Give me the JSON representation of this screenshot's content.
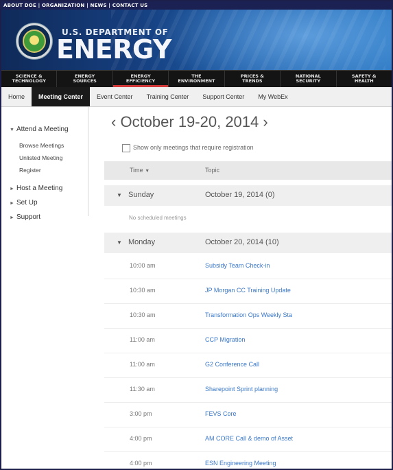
{
  "utility_nav": "ABOUT DOE | ORGANIZATION | NEWS | CONTACT US",
  "banner": {
    "dept": "U.S. DEPARTMENT OF",
    "name": "ENERGY"
  },
  "categories": [
    "SCIENCE &\nTECHNOLOGY",
    "ENERGY\nSOURCES",
    "ENERGY\nEFFICIENCY",
    "THE\nENVIRONMENT",
    "PRICES &\nTRENDS",
    "NATIONAL\nSECURITY",
    "SAFETY &\nHEALTH"
  ],
  "tabs": [
    "Home",
    "Meeting Center",
    "Event Center",
    "Training Center",
    "Support Center",
    "My WebEx"
  ],
  "active_tab": "Meeting Center",
  "sidebar": {
    "attend": "Attend a Meeting",
    "attend_items": [
      "Browse Meetings",
      "Unlisted Meeting",
      "Register"
    ],
    "host": "Host a Meeting",
    "setup": "Set Up",
    "support": "Support"
  },
  "main": {
    "week_title": "October 19-20, 2014",
    "checkbox_label": "Show only meetings that require registration",
    "col_time": "Time",
    "col_topic": "Topic"
  },
  "days": [
    {
      "name": "Sunday",
      "date": "October 19, 2014 (0)",
      "empty_message": "No scheduled meetings"
    },
    {
      "name": "Monday",
      "date": "October 20, 2014 (10)",
      "meetings": [
        {
          "time": "10:00 am",
          "topic": "Subsidy Team Check-in"
        },
        {
          "time": "10:30 am",
          "topic": "JP Morgan CC Training Update"
        },
        {
          "time": "10:30 am",
          "topic": "Transformation Ops Weekly Sta"
        },
        {
          "time": "11:00 am",
          "topic": "CCP Migration"
        },
        {
          "time": "11:00 am",
          "topic": "G2 Conference Call"
        },
        {
          "time": "11:30 am",
          "topic": "Sharepoint Sprint planning"
        },
        {
          "time": "3:00 pm",
          "topic": "FEVS Core"
        },
        {
          "time": "4:00 pm",
          "topic": "AM CORE Call & demo of Asset"
        },
        {
          "time": "4:00 pm",
          "topic": "ESN Engineering Meeting"
        }
      ]
    }
  ]
}
